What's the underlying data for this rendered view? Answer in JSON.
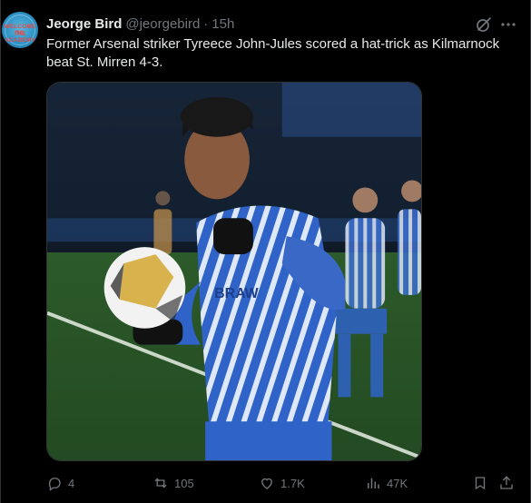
{
  "author": {
    "display_name": "Jeorge Bird",
    "handle": "@jeorgebird",
    "separator": "·",
    "time": "15h",
    "avatar_text_line1": "WELCOME TO",
    "avatar_text_line2": "THE ACADEMY"
  },
  "tweet": {
    "text": "Former Arsenal striker Tyreece John-Jules scored a hat-trick as Kilmarnock beat St. Mirren 4-3."
  },
  "media": {
    "kit_sponsor_text": "BRAW"
  },
  "actions": {
    "replies": "4",
    "reposts": "105",
    "likes": "1.7K",
    "views": "47K"
  },
  "icons": {
    "grok": "grok-icon",
    "more": "more-icon",
    "reply": "reply-icon",
    "repost": "repost-icon",
    "like": "heart-icon",
    "views": "views-icon",
    "bookmark": "bookmark-icon",
    "share": "share-icon"
  },
  "colors": {
    "background": "#000000",
    "text_primary": "#e7e9ea",
    "text_secondary": "#71767b",
    "border": "#2f3336",
    "kit_blue": "#2f63c8"
  }
}
